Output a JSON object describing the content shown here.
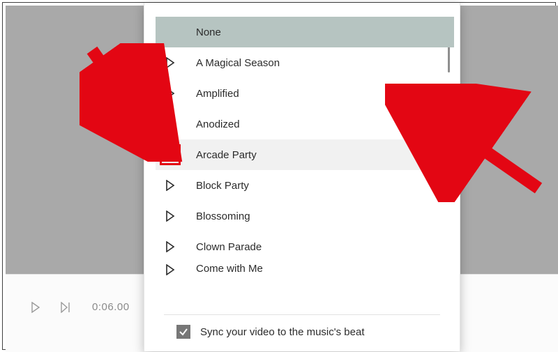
{
  "music_list": {
    "items": [
      {
        "label": "None",
        "selected": true,
        "hover": false,
        "has_play": false,
        "highlighted_play": false
      },
      {
        "label": "A Magical Season",
        "selected": false,
        "hover": false,
        "has_play": true,
        "highlighted_play": false
      },
      {
        "label": "Amplified",
        "selected": false,
        "hover": false,
        "has_play": true,
        "highlighted_play": false
      },
      {
        "label": "Anodized",
        "selected": false,
        "hover": false,
        "has_play": true,
        "highlighted_play": false
      },
      {
        "label": "Arcade Party",
        "selected": false,
        "hover": true,
        "has_play": true,
        "highlighted_play": true
      },
      {
        "label": "Block Party",
        "selected": false,
        "hover": false,
        "has_play": true,
        "highlighted_play": false
      },
      {
        "label": "Blossoming",
        "selected": false,
        "hover": false,
        "has_play": true,
        "highlighted_play": false
      },
      {
        "label": "Clown Parade",
        "selected": false,
        "hover": false,
        "has_play": true,
        "highlighted_play": false
      },
      {
        "label": "Come with Me",
        "selected": false,
        "hover": false,
        "has_play": true,
        "highlighted_play": false
      }
    ]
  },
  "sync": {
    "label": "Sync your video to the music's beat",
    "checked": true
  },
  "timeline": {
    "timecode": "0:06.00"
  },
  "annotation": {
    "color": "#e30613"
  }
}
